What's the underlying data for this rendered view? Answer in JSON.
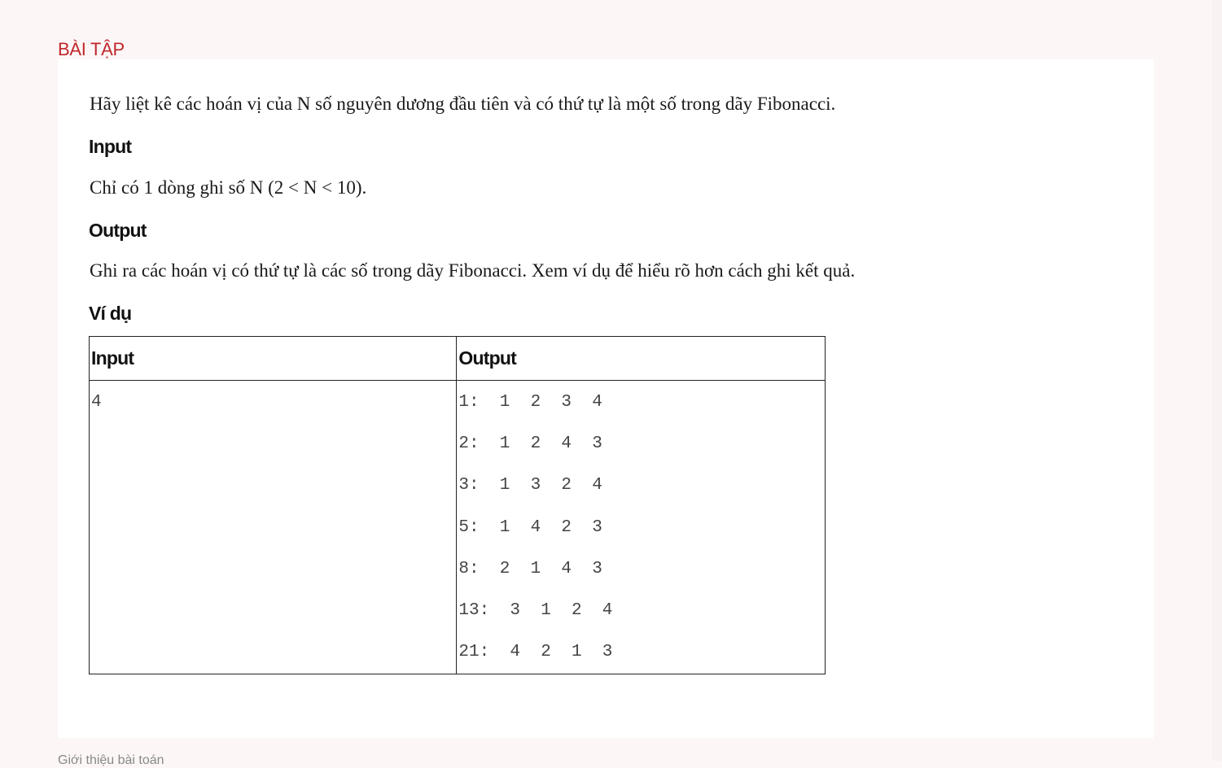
{
  "section": {
    "title": "BÀI TẬP"
  },
  "problem": {
    "statement": "Hãy liệt kê các hoán vị của N số nguyên dương đầu tiên và có thứ tự là một số trong dãy Fibonacci.",
    "input_heading": "Input",
    "input_text": "Chỉ có 1 dòng ghi số N (2 < N < 10).",
    "output_heading": "Output",
    "output_text": "Ghi ra các hoán vị có thứ tự là các số trong dãy Fibonacci. Xem ví dụ để hiểu rõ hơn cách ghi kết quả.",
    "example_heading": "Ví dụ"
  },
  "example_table": {
    "headers": [
      "Input",
      "Output"
    ],
    "input_lines": [
      "4"
    ],
    "output_lines": [
      "1:  1  2  3  4",
      "2:  1  2  4  3",
      "3:  1  3  2  4",
      "5:  1  4  2  3",
      "8:  2  1  4  3",
      "13:  3  1  2  4",
      "21:  4  2  1  3"
    ]
  },
  "footer": {
    "peek_text": "Giới thiệu bài toán"
  }
}
